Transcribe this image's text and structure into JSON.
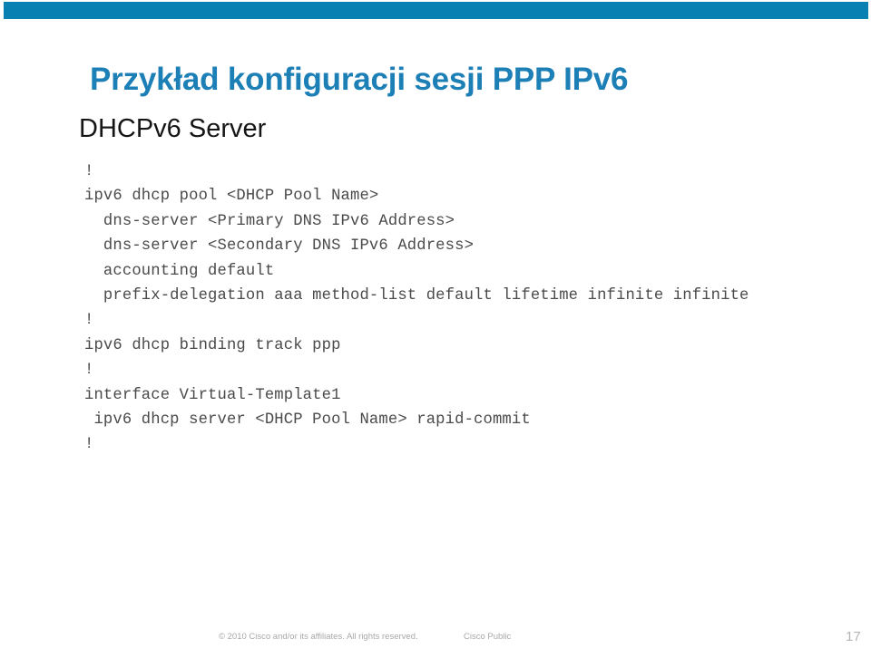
{
  "theme": {
    "accent_bar_color": "#0880B2",
    "title_color": "#1C7FB6",
    "subtitle_color": "#161616",
    "code_color": "#4A4A4A",
    "footer_color": "#A9A9A9",
    "background_color": "#FFFFFF"
  },
  "slide": {
    "title": "Przykład konfiguracji sesji PPP IPv6",
    "subtitle": "DHCPv6 Server"
  },
  "config": {
    "lines": [
      "!",
      "ipv6 dhcp pool <DHCP Pool Name>",
      "  dns-server <Primary DNS IPv6 Address>",
      "  dns-server <Secondary DNS IPv6 Address>",
      "  accounting default",
      "  prefix-delegation aaa method-list default lifetime infinite infinite",
      "!",
      "ipv6 dhcp binding track ppp",
      "!",
      "interface Virtual-Template1",
      " ipv6 dhcp server <DHCP Pool Name> rapid-commit",
      "!"
    ]
  },
  "footer": {
    "copyright": "© 2010 Cisco and/or its affiliates. All rights reserved.",
    "classification": "Cisco Public",
    "page_number": "17"
  }
}
